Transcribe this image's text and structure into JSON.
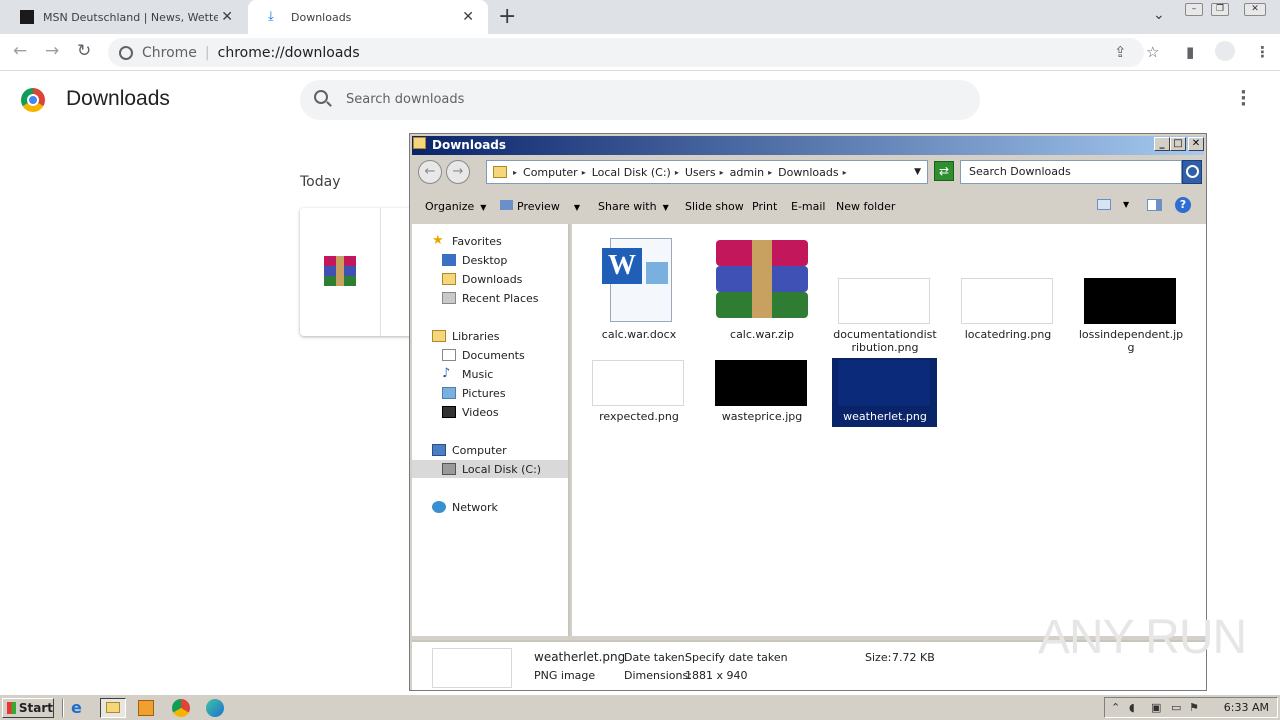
{
  "browser": {
    "tabs": [
      {
        "title": "MSN Deutschland | News, Wetter, Sp"
      },
      {
        "title": "Downloads"
      }
    ],
    "new_tab_symbol": "+",
    "omnibox": {
      "scheme_label": "Chrome",
      "separator": "|",
      "url": "chrome://downloads"
    }
  },
  "downloads_page": {
    "title": "Downloads",
    "search_placeholder": "Search downloads",
    "section_label": "Today"
  },
  "explorer": {
    "title": "Downloads",
    "breadcrumbs": [
      "Computer",
      "Local Disk (C:)",
      "Users",
      "admin",
      "Downloads"
    ],
    "search_placeholder": "Search Downloads",
    "commands": [
      "Organize",
      "Preview",
      "Share with",
      "Slide show",
      "Print",
      "E-mail",
      "New folder"
    ],
    "nav": {
      "favorites_header": "Favorites",
      "favorites": [
        "Desktop",
        "Downloads",
        "Recent Places"
      ],
      "libraries_header": "Libraries",
      "libraries": [
        "Documents",
        "Music",
        "Pictures",
        "Videos"
      ],
      "computer_header": "Computer",
      "computer_items": [
        "Local Disk (C:)"
      ],
      "network_header": "Network"
    },
    "files": [
      {
        "name": "calc.war.docx",
        "kind": "word-icon"
      },
      {
        "name": "calc.war.zip",
        "kind": "winrar-icon"
      },
      {
        "name": "documentationdistribution.png",
        "kind": "white-thumb"
      },
      {
        "name": "locatedring.png",
        "kind": "white-thumb"
      },
      {
        "name": "lossindependent.jpg",
        "kind": "black-thumb"
      },
      {
        "name": "rexpected.png",
        "kind": "white-thumb"
      },
      {
        "name": "wasteprice.jpg",
        "kind": "black-thumb"
      },
      {
        "name": "weatherlet.png",
        "kind": "selected-thumb"
      }
    ],
    "details": {
      "name": "weatherlet.png",
      "type": "PNG image",
      "date_label": "Date taken:",
      "date_value": "Specify date taken",
      "dim_label": "Dimensions:",
      "dim_value": "1881 x 940",
      "size_label": "Size:",
      "size_value": "7.72 KB"
    }
  },
  "watermark": "ANY RUN",
  "taskbar": {
    "start_label": "Start",
    "clock": "6:33 AM"
  }
}
